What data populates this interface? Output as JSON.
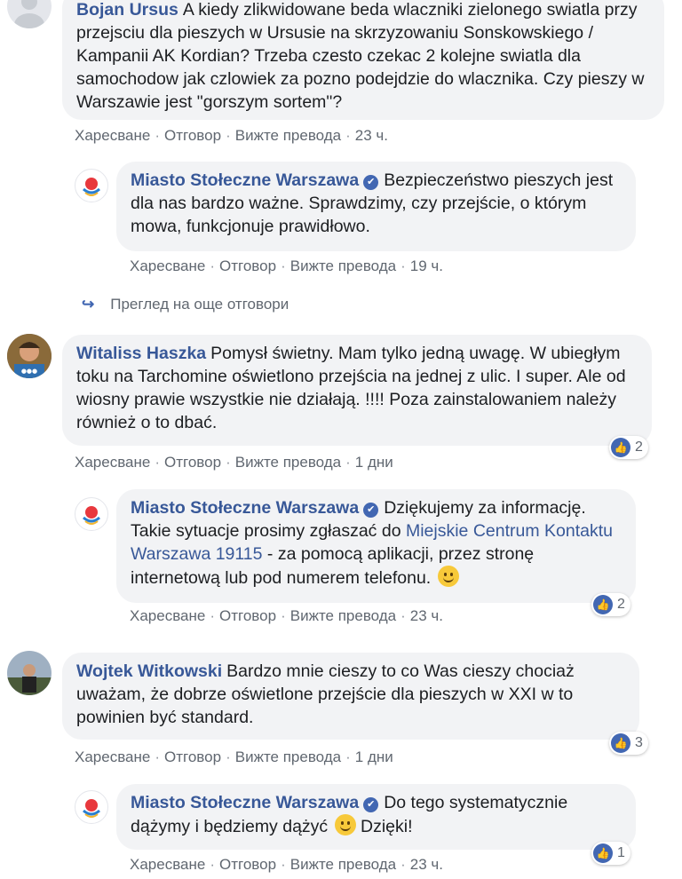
{
  "actions": {
    "like": "Харесване",
    "reply": "Отговор",
    "translate": "Вижте превода"
  },
  "more_replies": "Преглед на още отговори",
  "comments": [
    {
      "author": "Bojan Ursus",
      "text": "A kiedy zlikwidowane beda wlaczniki zielonego swiatla przy przejsciu dla pieszych w Ursusie na skrzyzowaniu Sonskowskiego / Kampanii AK Kordian? Trzeba czesto czekac 2 kolejne swiatla dla samochodow jak czlowiek za pozno podejdzie do wlacznika. Czy pieszy w Warszawie jest \"gorszym sortem\"?",
      "time": "23 ч."
    },
    {
      "author": "Miasto Stołeczne Warszawa",
      "text": "Bezpieczeństwo pieszych jest dla nas bardzo ważne. Sprawdzimy, czy przejście, o którym mowa, funkcjonuje prawidłowo.",
      "time": "19 ч."
    },
    {
      "author": "Witaliss Haszka",
      "text": "Pomysł świetny. Mam tylko jedną uwagę. W ubiegłym toku na Tarchomine oświetlono przejścia na jednej z ulic. I super. Ale od wiosny prawie wszystkie nie działają. !!!! Poza zainstalowaniem należy również o to dbać.",
      "time": "1 дни",
      "reactions": "2"
    },
    {
      "author": "Miasto Stołeczne Warszawa",
      "text_before": "Dziękujemy za informację. Takie sytuacje prosimy zgłaszać do",
      "link": "Miejskie Centrum Kontaktu Warszawa 19115",
      "text_after": "- za pomocą aplikacji, przez stronę internetową lub pod numerem telefonu.",
      "time": "23 ч.",
      "reactions": "2"
    },
    {
      "author": "Wojtek Witkowski",
      "text": "Bardzo mnie cieszy to co Was cieszy chociaż uważam, że dobrze oświetlone przejście dla pieszych w XXI w to powinien być standard.",
      "time": "1 дни",
      "reactions": "3"
    },
    {
      "author": "Miasto Stołeczne Warszawa",
      "text_before": "Do tego systematycznie dążymy i będziemy dążyć",
      "text_after": "Dzięki!",
      "time": "23 ч.",
      "reactions": "1"
    }
  ],
  "colors": {
    "link": "#385898",
    "bubble": "#f2f3f5",
    "meta": "#606770",
    "like": "#4267b2"
  },
  "icons": [
    "verified-badge-icon",
    "reply-arrow-icon",
    "like-icon",
    "smile-emoji-icon"
  ]
}
